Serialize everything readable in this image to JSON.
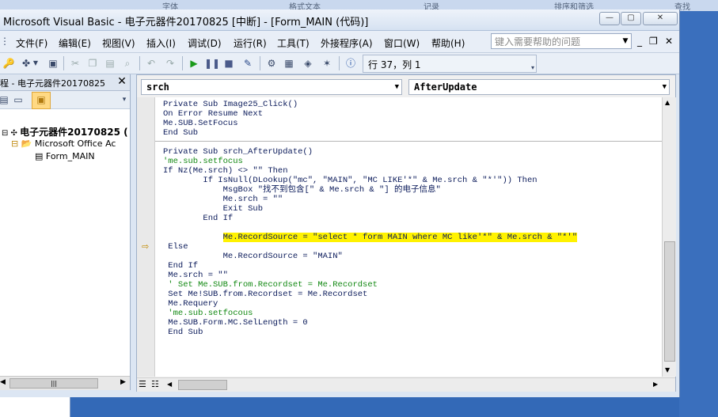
{
  "background": {
    "tabs": [
      "字体",
      "格式文本",
      "记录",
      "排序和筛选",
      "查找"
    ]
  },
  "window": {
    "title": "Microsoft Visual Basic - 电子元器件20170825 [中断] - [Form_MAIN (代码)]",
    "minimize": "—",
    "restore": "▢",
    "close": "✕"
  },
  "menu": {
    "items": [
      "文件(F)",
      "编辑(E)",
      "视图(V)",
      "插入(I)",
      "调试(D)",
      "运行(R)",
      "工具(T)",
      "外接程序(A)",
      "窗口(W)",
      "帮助(H)"
    ],
    "help_placeholder": "键入需要帮助的问题",
    "mdi_min": "_",
    "mdi_restore": "❐",
    "mdi_close": "✕"
  },
  "toolbar": {
    "cursor_position": "行 37，列 1"
  },
  "project": {
    "title": "程 - 电子元器件20170825",
    "close": "✕",
    "tree": [
      {
        "label": "电子元器件20170825  (",
        "bold": true
      },
      {
        "label": "Microsoft Office Ac",
        "bold": false
      },
      {
        "label": "Form_MAIN",
        "bold": false
      }
    ],
    "scroll_thumb": "|||"
  },
  "code": {
    "object_combo": "srch",
    "procedure_combo": "AfterUpdate",
    "lines": [
      {
        "text": "Private Sub Image25_Click()",
        "type": "code"
      },
      {
        "text": "On Error Resume Next",
        "type": "code"
      },
      {
        "text": "Me.SUB.SetFocus",
        "type": "code"
      },
      {
        "text": "End Sub",
        "type": "code"
      },
      {
        "text": "",
        "type": "sep"
      },
      {
        "text": "Private Sub srch_AfterUpdate()",
        "type": "code"
      },
      {
        "text": "'me.sub.setfocus",
        "type": "comment"
      },
      {
        "text": "If Nz(Me.srch) <> \"\" Then",
        "type": "code"
      },
      {
        "text": "        If IsNull(DLookup(\"mc\", \"MAIN\", \"MC LIKE'*\" & Me.srch & \"*'\")) Then",
        "type": "code"
      },
      {
        "text": "            MsgBox \"找不到包含[\" & Me.srch & \"] 的电子信息\"",
        "type": "code"
      },
      {
        "text": "            Me.srch = \"\"",
        "type": "code"
      },
      {
        "text": "            Exit Sub",
        "type": "code"
      },
      {
        "text": "        End If",
        "type": "code"
      },
      {
        "text": "",
        "type": "code"
      },
      {
        "text": "            Me.RecordSource = \"select * form MAIN where MC like'*\" & Me.srch & \"*'\"",
        "type": "highlight"
      },
      {
        "text": " Else",
        "type": "code"
      },
      {
        "text": "            Me.RecordSource = \"MAIN\"",
        "type": "code"
      },
      {
        "text": " End If",
        "type": "code"
      },
      {
        "text": " Me.srch = \"\"",
        "type": "code"
      },
      {
        "text": " ' Set Me.SUB.from.Recordset = Me.Recordset",
        "type": "comment"
      },
      {
        "text": " Set Me!SUB.from.Recordset = Me.Recordset",
        "type": "code"
      },
      {
        "text": " Me.Requery",
        "type": "code"
      },
      {
        "text": " 'me.sub.setfocous",
        "type": "comment"
      },
      {
        "text": " Me.SUB.Form.MC.SelLength = 0",
        "type": "code"
      },
      {
        "text": " End Sub",
        "type": "code"
      }
    ]
  }
}
